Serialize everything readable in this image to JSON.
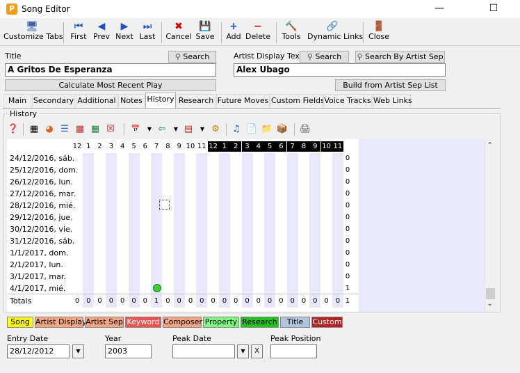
{
  "window": {
    "title": "Song Editor",
    "icon_letter": "P"
  },
  "toolbar": {
    "customize_tabs": "Customize Tabs",
    "first": "First",
    "prev": "Prev",
    "next": "Next",
    "last": "Last",
    "cancel": "Cancel",
    "save": "Save",
    "add": "Add",
    "delete": "Delete",
    "tools": "Tools",
    "dynamic_links": "Dynamic Links",
    "close": "Close"
  },
  "form": {
    "title_label": "Title",
    "search_label": "Search",
    "title_value": "A Gritos De Esperanza",
    "artist_label": "Artist Display Text",
    "artist_search": "Search",
    "search_by_artist_sep": "Search By Artist Sep",
    "artist_value": "Alex Ubago",
    "calc_recent_play": "Calculate Most Recent Play",
    "build_title": "Build from Artist Sep List"
  },
  "tabs": [
    "Main",
    "Secondary",
    "Additional",
    "Notes",
    "History",
    "Research",
    "Future Moves",
    "Custom Fields",
    "Voice Tracks",
    "Web Links"
  ],
  "active_tab": "History",
  "history": {
    "group_label": "History",
    "hours": [
      "12",
      "1",
      "2",
      "3",
      "4",
      "5",
      "6",
      "7",
      "8",
      "9",
      "10",
      "11",
      "12",
      "1",
      "2",
      "3",
      "4",
      "5",
      "6",
      "7",
      "8",
      "9",
      "10",
      "11"
    ],
    "rows": [
      {
        "date": "24/12/2016, sáb.",
        "total": "0"
      },
      {
        "date": "25/12/2016, dom.",
        "total": "0"
      },
      {
        "date": "26/12/2016, lun.",
        "total": "0"
      },
      {
        "date": "27/12/2016, mar.",
        "total": "0"
      },
      {
        "date": "28/12/2016, mié.",
        "total": "0"
      },
      {
        "date": "29/12/2016, jue.",
        "total": "0"
      },
      {
        "date": "30/12/2016, vie.",
        "total": "0"
      },
      {
        "date": "31/12/2016, sáb.",
        "total": "0"
      },
      {
        "date": "1/1/2017, dom.",
        "total": "0"
      },
      {
        "date": "2/1/2017, lun.",
        "total": "0"
      },
      {
        "date": "3/1/2017, mar.",
        "total": "0"
      },
      {
        "date": "4/1/2017, mié.",
        "total": "1"
      }
    ],
    "totals_label": "Totals",
    "totals": [
      "0",
      "0",
      "0",
      "0",
      "0",
      "0",
      "0",
      "1",
      "0",
      "0",
      "0",
      "0",
      "0",
      "0",
      "0",
      "0",
      "0",
      "0",
      "0",
      "0",
      "0",
      "0",
      "0",
      "0"
    ],
    "grand_total": "1"
  },
  "categories": [
    {
      "label": "Song",
      "color": "#ffff00"
    },
    {
      "label": "Artist Display",
      "color": "#f4a582"
    },
    {
      "label": "Artist Sep",
      "color": "#f4a582"
    },
    {
      "label": "Keyword",
      "color": "#ef5350"
    },
    {
      "label": "Composer",
      "color": "#f4a582"
    },
    {
      "label": "Property",
      "color": "#80ff80"
    },
    {
      "label": "Research",
      "color": "#22c322"
    },
    {
      "label": "Title",
      "color": "#b0c4de"
    },
    {
      "label": "Custom",
      "color": "#b22222"
    }
  ],
  "fields": {
    "entry_date_label": "Entry Date",
    "entry_date_value": "28/12/2012",
    "year_label": "Year",
    "year_value": "2003",
    "peak_date_label": "Peak Date",
    "peak_date_value": "",
    "peak_date_clear": "X",
    "peak_position_label": "Peak Position",
    "peak_position_value": ""
  }
}
